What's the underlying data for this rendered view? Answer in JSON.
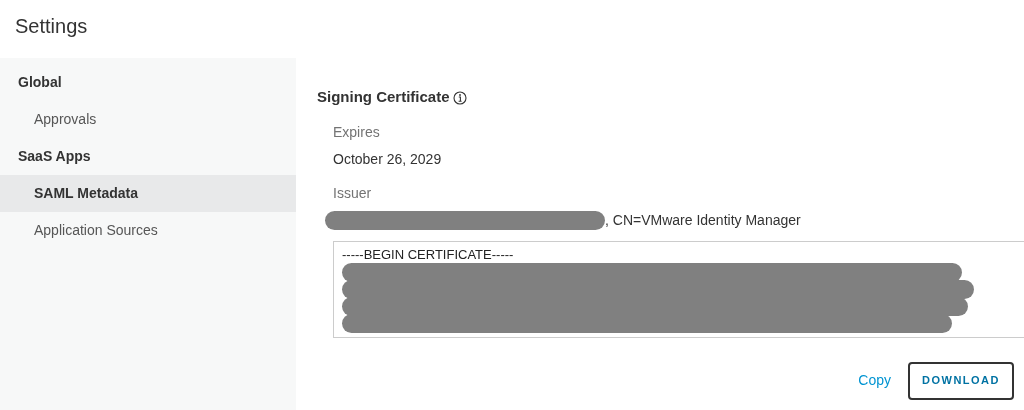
{
  "page": {
    "title": "Settings"
  },
  "sidebar": {
    "items": [
      {
        "label": "Global",
        "kind": "header",
        "selected": false
      },
      {
        "label": "Approvals",
        "kind": "item",
        "selected": false
      },
      {
        "label": "SaaS Apps",
        "kind": "header",
        "selected": false
      },
      {
        "label": "SAML Metadata",
        "kind": "item",
        "selected": true
      },
      {
        "label": "Application Sources",
        "kind": "item",
        "selected": false
      }
    ]
  },
  "certificate": {
    "title": "Signing Certificate",
    "fields": [
      {
        "label": "Expires",
        "value": "October 26, 2029",
        "redacted": false
      },
      {
        "label": "Issuer",
        "value": ", CN=VMware Identity Manager",
        "redacted": true
      }
    ],
    "pem_header": "-----BEGIN CERTIFICATE-----",
    "actions": {
      "copy": "Copy",
      "download": "DOWNLOAD"
    }
  }
}
